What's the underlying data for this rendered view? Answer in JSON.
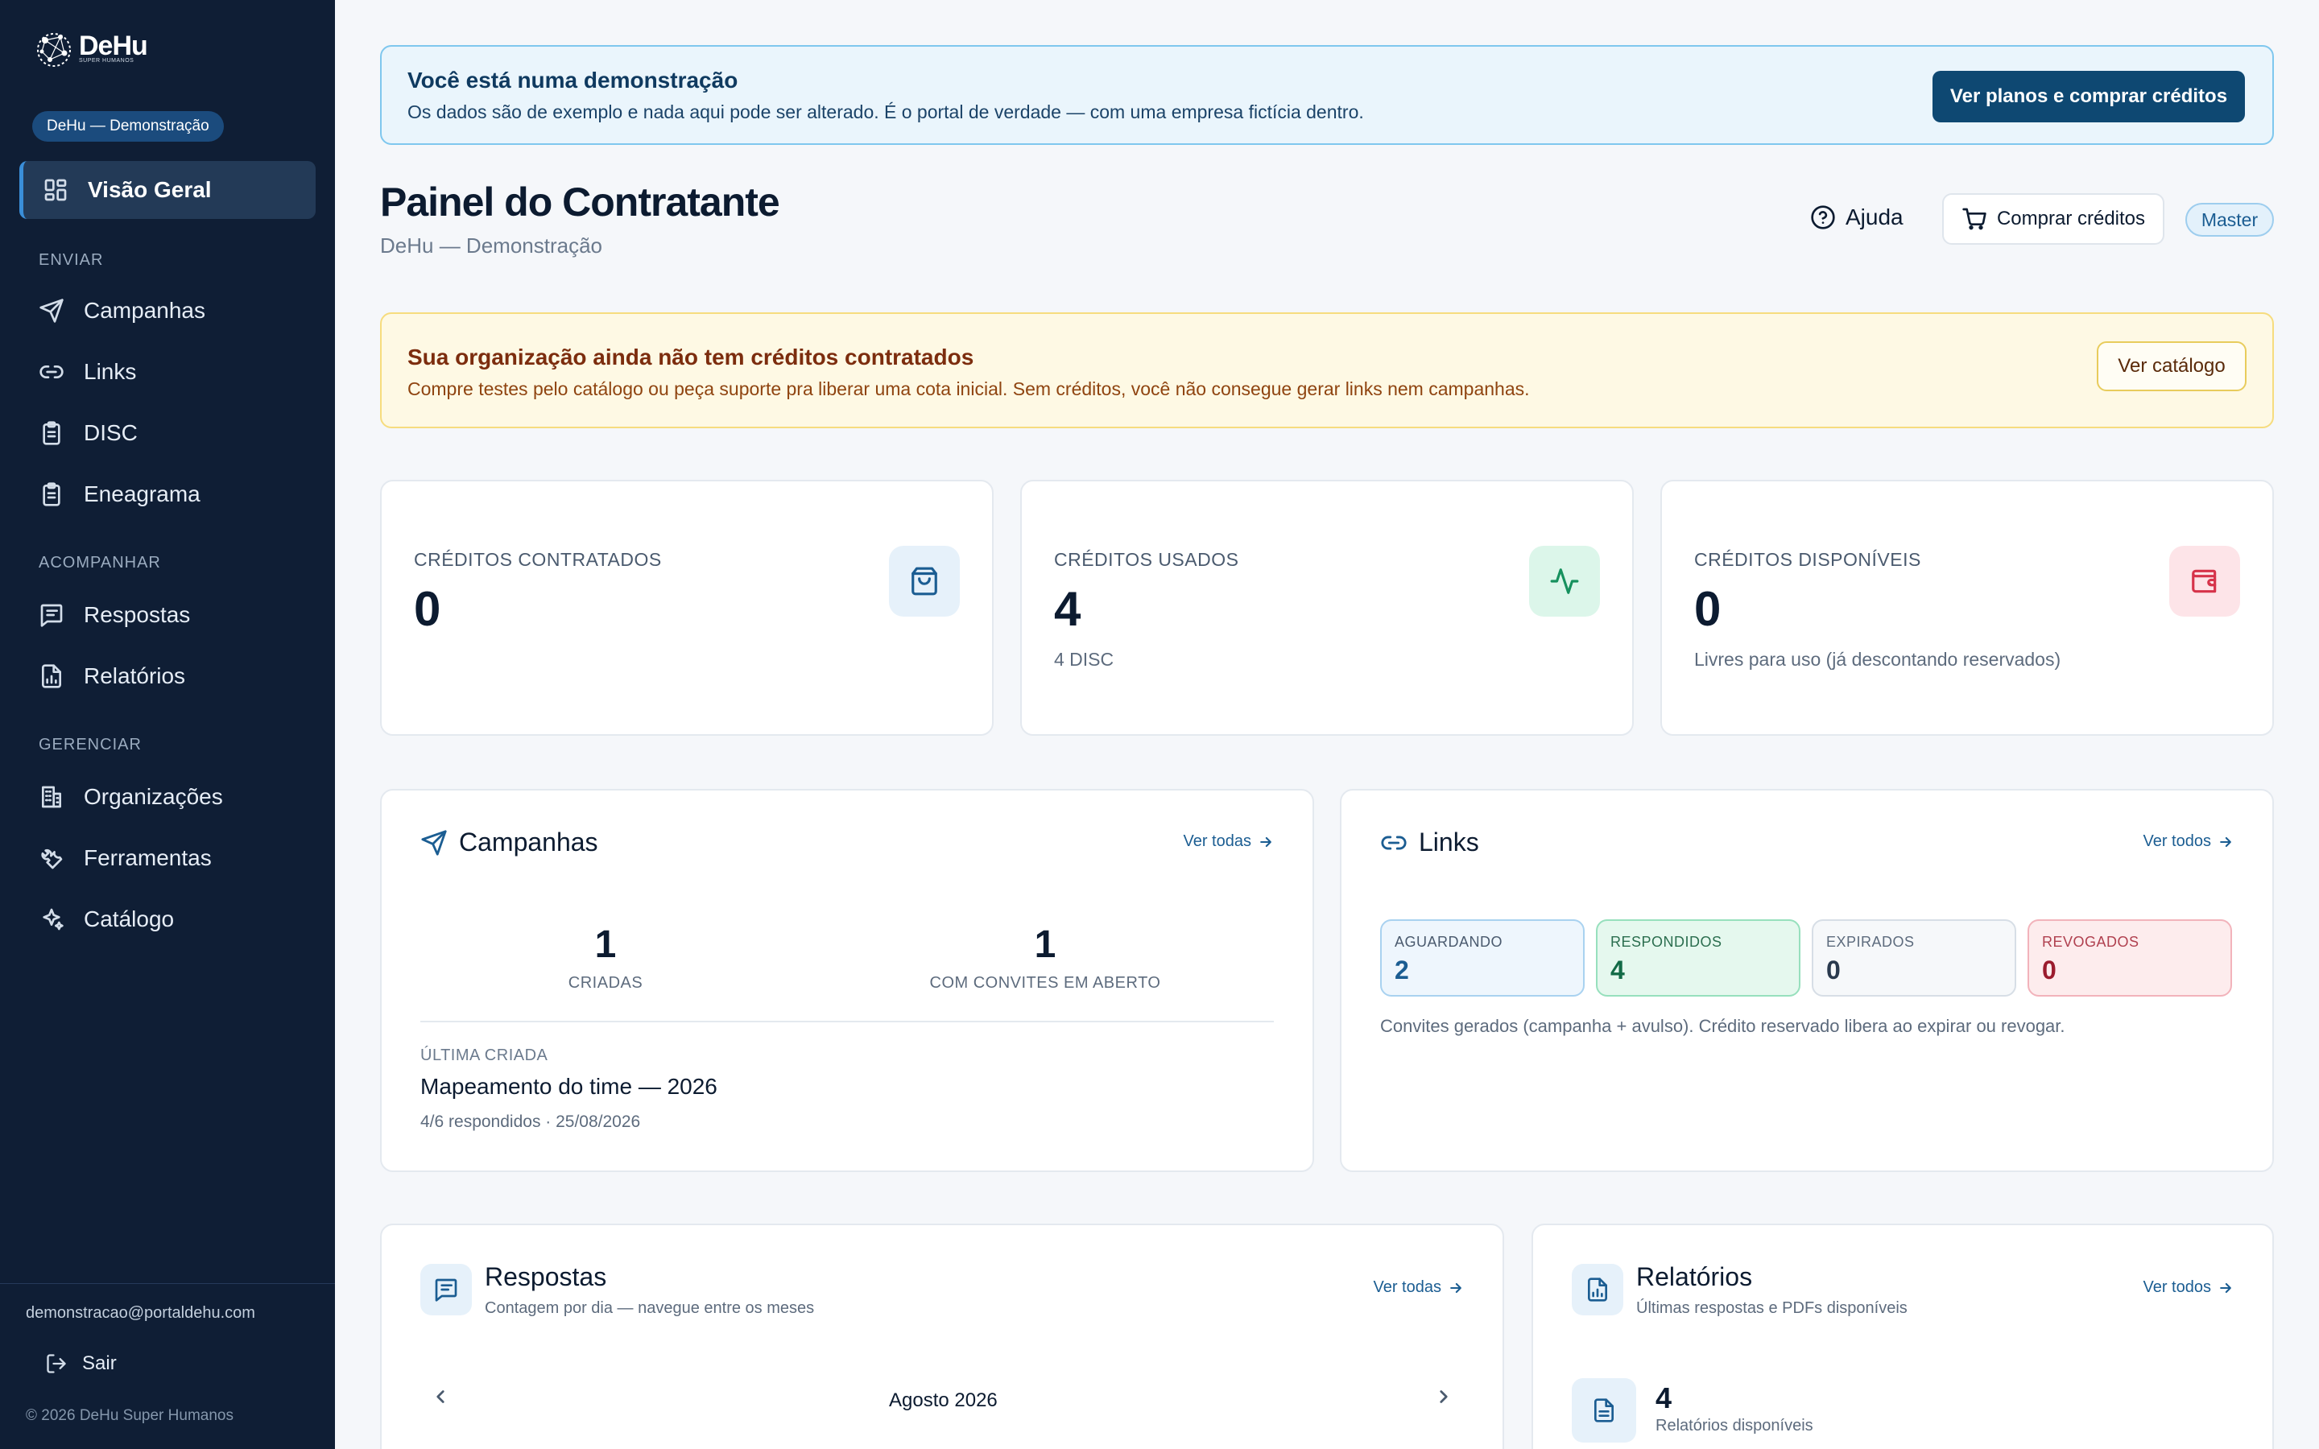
{
  "app": {
    "logo_text": "DeHu",
    "logo_sub": "SUPER HUMANOS",
    "org_badge": "DeHu — Demonstração"
  },
  "sidebar": {
    "main_item": "Visão Geral",
    "sections": [
      {
        "title": "ENVIAR",
        "items": [
          "Campanhas",
          "Links",
          "DISC",
          "Eneagrama"
        ]
      },
      {
        "title": "ACOMPANHAR",
        "items": [
          "Respostas",
          "Relatórios"
        ]
      },
      {
        "title": "GERENCIAR",
        "items": [
          "Organizações",
          "Ferramentas",
          "Catálogo"
        ]
      }
    ],
    "user_email": "demonstracao@portaldehu.com",
    "logout": "Sair",
    "copyright": "© 2026 DeHu Super Humanos"
  },
  "demo_banner": {
    "title": "Você está numa demonstração",
    "text": "Os dados são de exemplo e nada aqui pode ser alterado. É o portal de verdade — com uma empresa fictícia dentro.",
    "button": "Ver planos e comprar créditos"
  },
  "header": {
    "title": "Painel do Contratante",
    "subtitle": "DeHu — Demonstração",
    "help": "Ajuda",
    "buy": "Comprar créditos",
    "role": "Master"
  },
  "warning": {
    "title": "Sua organização ainda não tem créditos contratados",
    "text": "Compre testes pelo catálogo ou peça suporte pra liberar uma cota inicial. Sem créditos, você não consegue gerar links nem campanhas.",
    "button": "Ver catálogo"
  },
  "stats": [
    {
      "label": "CRÉDITOS CONTRATADOS",
      "value": "0",
      "sub": "",
      "icon": "shopping-bag-icon",
      "color": "#1b5d92",
      "bg": "#e6f1fa"
    },
    {
      "label": "CRÉDITOS USADOS",
      "value": "4",
      "sub": "4 DISC",
      "icon": "activity-icon",
      "color": "#16915e",
      "bg": "#dcf6ea"
    },
    {
      "label": "CRÉDITOS DISPONÍVEIS",
      "value": "0",
      "sub": "Livres para uso (já descontando reservados)",
      "icon": "wallet-icon",
      "color": "#d6334a",
      "bg": "#fde4e8"
    }
  ],
  "campaigns": {
    "title": "Campanhas",
    "see_all": "Ver todas",
    "created_value": "1",
    "created_label": "CRIADAS",
    "open_value": "1",
    "open_label": "COM CONVITES EM ABERTO",
    "last_label": "ÚLTIMA CRIADA",
    "last_name": "Mapeamento do time — 2026",
    "last_meta": "4/6 respondidos · 25/08/2026"
  },
  "links": {
    "title": "Links",
    "see_all": "Ver todos",
    "boxes": [
      {
        "label": "AGUARDANDO",
        "value": "2",
        "color": "#1b5d92",
        "bg": "#eef6fd",
        "border": "#a9d2f0"
      },
      {
        "label": "RESPONDIDOS",
        "value": "4",
        "color": "#136b47",
        "bg": "#e5f8ee",
        "border": "#97e0bd"
      },
      {
        "label": "EXPIRADOS",
        "value": "0",
        "color": "#4a5a6e",
        "bg": "#f6f8fa",
        "border": "#d7dee6"
      },
      {
        "label": "REVOGADOS",
        "value": "0",
        "color": "#9b1c2e",
        "bg": "#fdeced",
        "border": "#f2b3bb"
      }
    ],
    "note": "Convites gerados (campanha + avulso). Crédito reservado libera ao expirar ou revogar."
  },
  "responses": {
    "title": "Respostas",
    "subtitle": "Contagem por dia — navegue entre os meses",
    "see_all": "Ver todas",
    "month": "Agosto 2026"
  },
  "reports": {
    "title": "Relatórios",
    "subtitle": "Últimas respostas e PDFs disponíveis",
    "see_all": "Ver todos",
    "count": "4",
    "count_label": "Relatórios disponíveis"
  }
}
